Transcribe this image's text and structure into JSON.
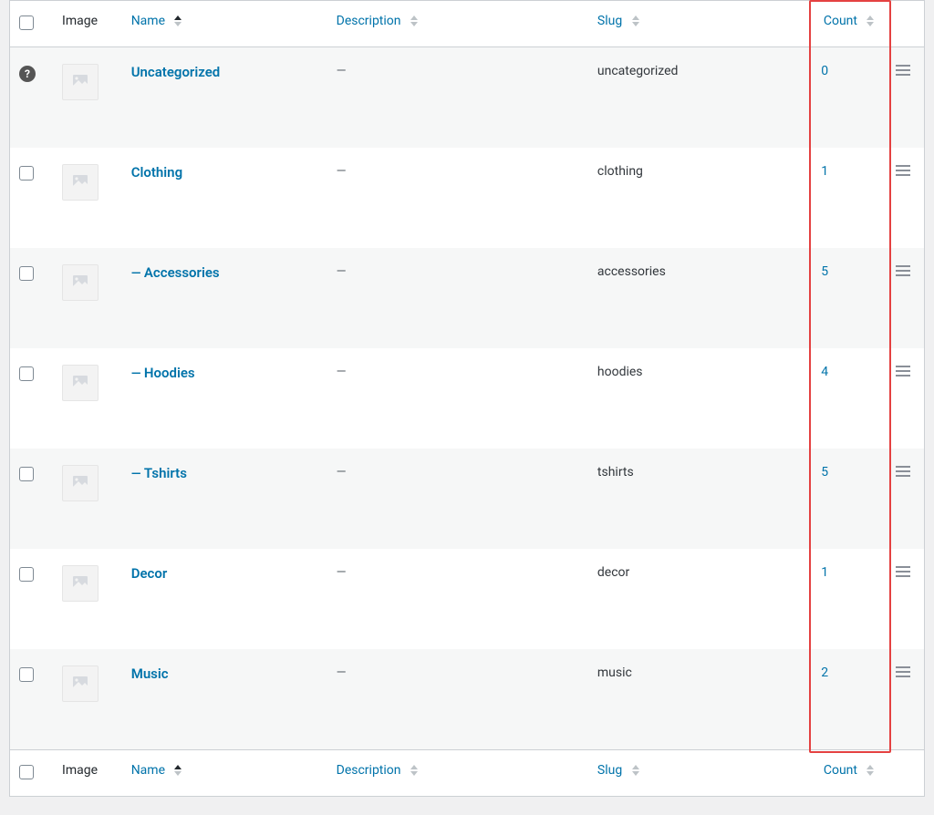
{
  "columns": {
    "image": "Image",
    "name": "Name",
    "description": "Description",
    "slug": "Slug",
    "count": "Count"
  },
  "rows": [
    {
      "indent": "",
      "name": "Uncategorized",
      "description": "—",
      "slug": "uncategorized",
      "count": "0",
      "help": true
    },
    {
      "indent": "",
      "name": "Clothing",
      "description": "—",
      "slug": "clothing",
      "count": "1",
      "help": false
    },
    {
      "indent": "— ",
      "name": "Accessories",
      "description": "—",
      "slug": "accessories",
      "count": "5",
      "help": false
    },
    {
      "indent": "— ",
      "name": "Hoodies",
      "description": "—",
      "slug": "hoodies",
      "count": "4",
      "help": false
    },
    {
      "indent": "— ",
      "name": "Tshirts",
      "description": "—",
      "slug": "tshirts",
      "count": "5",
      "help": false
    },
    {
      "indent": "",
      "name": "Decor",
      "description": "—",
      "slug": "decor",
      "count": "1",
      "help": false
    },
    {
      "indent": "",
      "name": "Music",
      "description": "—",
      "slug": "music",
      "count": "2",
      "help": false
    }
  ],
  "icons": {
    "help": "?",
    "more": "≡"
  }
}
